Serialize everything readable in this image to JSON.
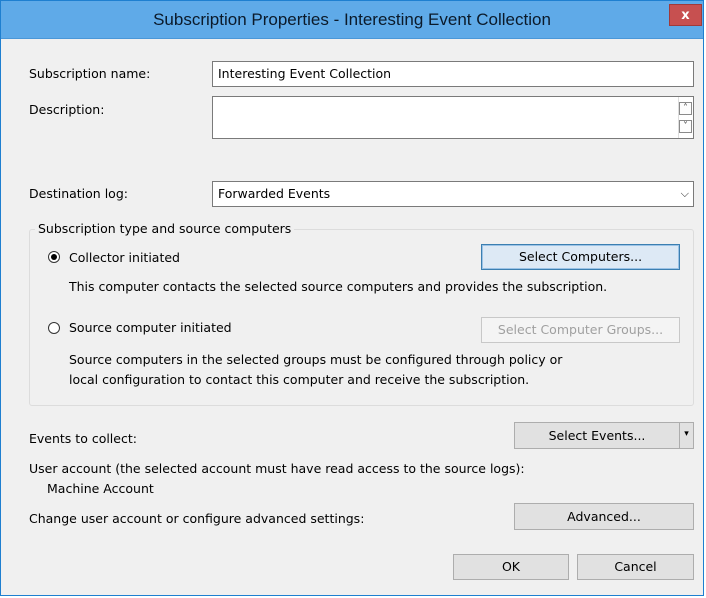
{
  "window": {
    "title": "Subscription Properties - Interesting Event Collection",
    "close_glyph": "x"
  },
  "form": {
    "name_label": "Subscription name:",
    "name_value": "Interesting Event Collection",
    "description_label": "Description:",
    "description_value": "",
    "destination_label": "Destination log:",
    "destination_value": "Forwarded Events"
  },
  "subscription_type": {
    "legend": "Subscription type and source computers",
    "collector_label": "Collector initiated",
    "collector_selected": true,
    "collector_button": "Select Computers...",
    "collector_description": "This computer contacts the selected source computers and provides the subscription.",
    "source_label": "Source computer initiated",
    "source_selected": false,
    "source_button": "Select Computer Groups...",
    "source_description_line1": "Source computers in the selected groups must be configured through policy or",
    "source_description_line2": "local configuration to contact this computer and receive the subscription."
  },
  "events": {
    "label": "Events to collect:",
    "button": "Select Events...",
    "dropdown_glyph": "▾"
  },
  "account": {
    "label": "User account (the selected account must have read access to the source logs):",
    "value": "Machine Account",
    "advanced_label": "Change user account or configure advanced settings:",
    "advanced_button": "Advanced..."
  },
  "footer": {
    "ok": "OK",
    "cancel": "Cancel"
  },
  "colors": {
    "titlebar": "#5faae8",
    "close_button": "#c75050",
    "dialog_bg": "#f0f0f0"
  }
}
